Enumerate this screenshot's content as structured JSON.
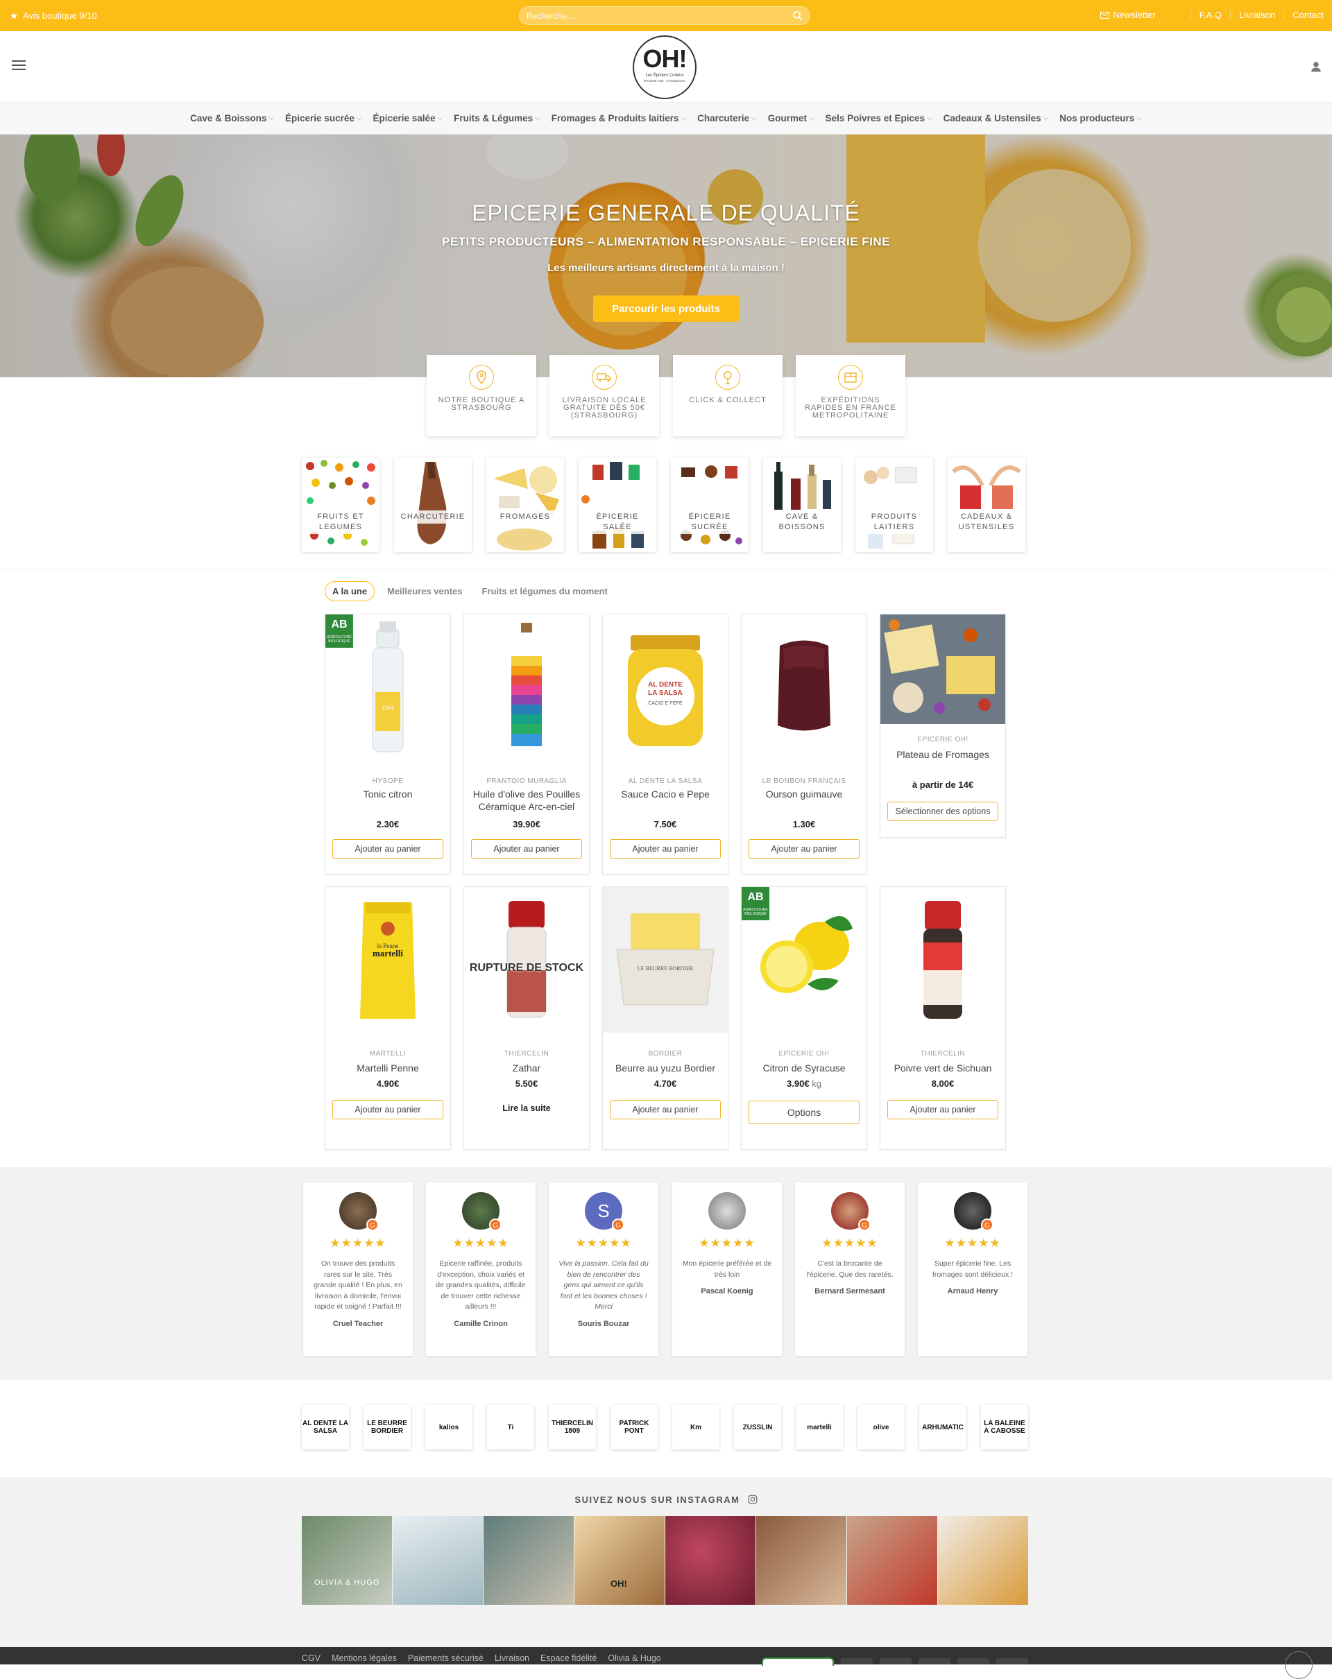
{
  "topbar": {
    "rating": "Avis boutique 9/10",
    "search_placeholder": "Recherche...",
    "links": {
      "newsletter": "Newsletter",
      "faq": "F.A.Q",
      "livraison": "Livraison",
      "contact": "Contact"
    }
  },
  "logo": {
    "big": "OH!",
    "line1": "Les Épiciers Curieux",
    "line2": "ÉPICERIE FINE · STRASBOURG"
  },
  "nav": [
    "Cave & Boissons",
    "Épicerie sucrée",
    "Épicerie salée",
    "Fruits & Légumes",
    "Fromages & Produits laitiers",
    "Charcuterie",
    "Gourmet",
    "Sels Poivres et Epices",
    "Cadeaux & Ustensiles",
    "Nos producteurs"
  ],
  "hero": {
    "title": "EPICERIE GENERALE DE QUALITÉ",
    "subtitle": "PETITS PRODUCTEURS – ALIMENTATION RESPONSABLE – EPICERIE FINE",
    "tagline": "Les meilleurs artisans directement à la maison !",
    "cta": "Parcourir les produits"
  },
  "features": [
    {
      "label": "NOTRE BOUTIQUE A STRASBOURG",
      "icon": "location-pin-icon"
    },
    {
      "label": "LIVRAISON LOCALE GRATUITE DÈS 50€ (STRASBOURG)",
      "icon": "delivery-truck-icon"
    },
    {
      "label": "CLICK & COLLECT",
      "icon": "click-collect-icon"
    },
    {
      "label": "EXPÉDITIONS RAPIDES EN FRANCE METROPOLITAINE",
      "icon": "shipping-box-icon"
    }
  ],
  "categories": [
    {
      "label1": "FRUITS ET",
      "label2": "LEGUMES"
    },
    {
      "label1": "CHARCUTERIE",
      "label2": ""
    },
    {
      "label1": "FROMAGES",
      "label2": ""
    },
    {
      "label1": "ÉPICERIE",
      "label2": "SALÉE"
    },
    {
      "label1": "ÉPICERIE",
      "label2": "SUCRÉE"
    },
    {
      "label1": "CAVE &",
      "label2": "BOISSONS"
    },
    {
      "label1": "PRODUITS",
      "label2": "LAITIERS"
    },
    {
      "label1": "CADEAUX &",
      "label2": "USTENSILES"
    }
  ],
  "tabs": [
    "A la une",
    "Meilleures ventes",
    "Fruits et légumes du moment"
  ],
  "products": [
    {
      "brand": "HYSOPE",
      "name": "Tonic citron",
      "price": "2.30€",
      "button": "Ajouter au panier",
      "bio": true
    },
    {
      "brand": "FRANTOIO MURAGLIA",
      "name": "Huile d'olive des Pouilles Céramique Arc-en-ciel",
      "price": "39.90€",
      "button": "Ajouter au panier"
    },
    {
      "brand": "AL DENTE LA SALSA",
      "name": "Sauce Cacio e Pepe",
      "price": "7.50€",
      "button": "Ajouter au panier"
    },
    {
      "brand": "LE BONBON FRANÇAIS",
      "name": "Ourson guimauve",
      "price": "1.30€",
      "button": "Ajouter au panier"
    },
    {
      "brand": "EPICERIE OH!",
      "name": "Plateau de Fromages",
      "price": "à partir de 14€",
      "button": "Sélectionner des options"
    },
    {
      "brand": "MARTELLI",
      "name": "Martelli Penne",
      "price": "4.90€",
      "button": "Ajouter au panier"
    },
    {
      "brand": "THIERCELIN",
      "name": "Zathar",
      "price": "5.50€",
      "button": "Lire la suite",
      "badge": "RUPTURE DE STOCK"
    },
    {
      "brand": "BORDIER",
      "name": "Beurre au yuzu Bordier",
      "price": "4.70€",
      "button": "Ajouter au panier"
    },
    {
      "brand": "EPICERIE OH!",
      "name": "Citron de Syracuse",
      "price": "3.90€",
      "unit": "kg",
      "button": "Options",
      "bio": true
    },
    {
      "brand": "THIERCELIN",
      "name": "Poivre vert de Sichuan",
      "price": "8.00€",
      "button": "Ajouter au panier"
    }
  ],
  "bio_label": {
    "big": "AB",
    "small": "AGRICULTURE BIOLOGIQUE"
  },
  "reviews": [
    {
      "text": "On trouve des produits rares sur le site. Très grande qualité ! En plus, en livraison à domicile, l'envoi rapide et soigné ! Parfait !!!",
      "author": "Cruel Teacher"
    },
    {
      "text": "Épicerie raffinée, produits d'exception, choix variés et de grandes qualités, difficile de trouver cette richesse ailleurs !!!",
      "author": "Camille Crinon"
    },
    {
      "text": "Vive la passion. Cela fait du bien de rencontrer des gens qui aiment ce qu'ils font et les bonnes choses ! Merci",
      "author": "Souris Bouzar",
      "initial": "S"
    },
    {
      "text": "Mon épicerie préférée et de très loin",
      "author": "Pascal Koenig"
    },
    {
      "text": "C'est la brocante de l'épicerie. Que des raretés.",
      "author": "Bernard Sermesant"
    },
    {
      "text": "Super épicerie fine. Les fromages sont délicieux !",
      "author": "Arnaud Henry"
    }
  ],
  "review_stars": "★★★★★",
  "brands": [
    "AL DENTE LA SALSA",
    "LE BEURRE BORDIER",
    "kalios",
    "Ti",
    "THIERCELIN 1809",
    "PATRICK PONT",
    "Km",
    "ZUSSLIN",
    "martelli",
    "olive",
    "ARHUMATIC",
    "LA BALEINE À CABOSSE"
  ],
  "instagram": {
    "title": "SUIVEZ NOUS SUR INSTAGRAM",
    "photo_texts": [
      "OLIVIA & HUGO",
      "",
      "",
      "OH!",
      "",
      "",
      "",
      ""
    ]
  },
  "footer": {
    "links": [
      "CGV",
      "Mentions légales",
      "Paiements sécurisé",
      "Livraison",
      "Espace fidélité",
      "Olivia & Hugo"
    ]
  }
}
